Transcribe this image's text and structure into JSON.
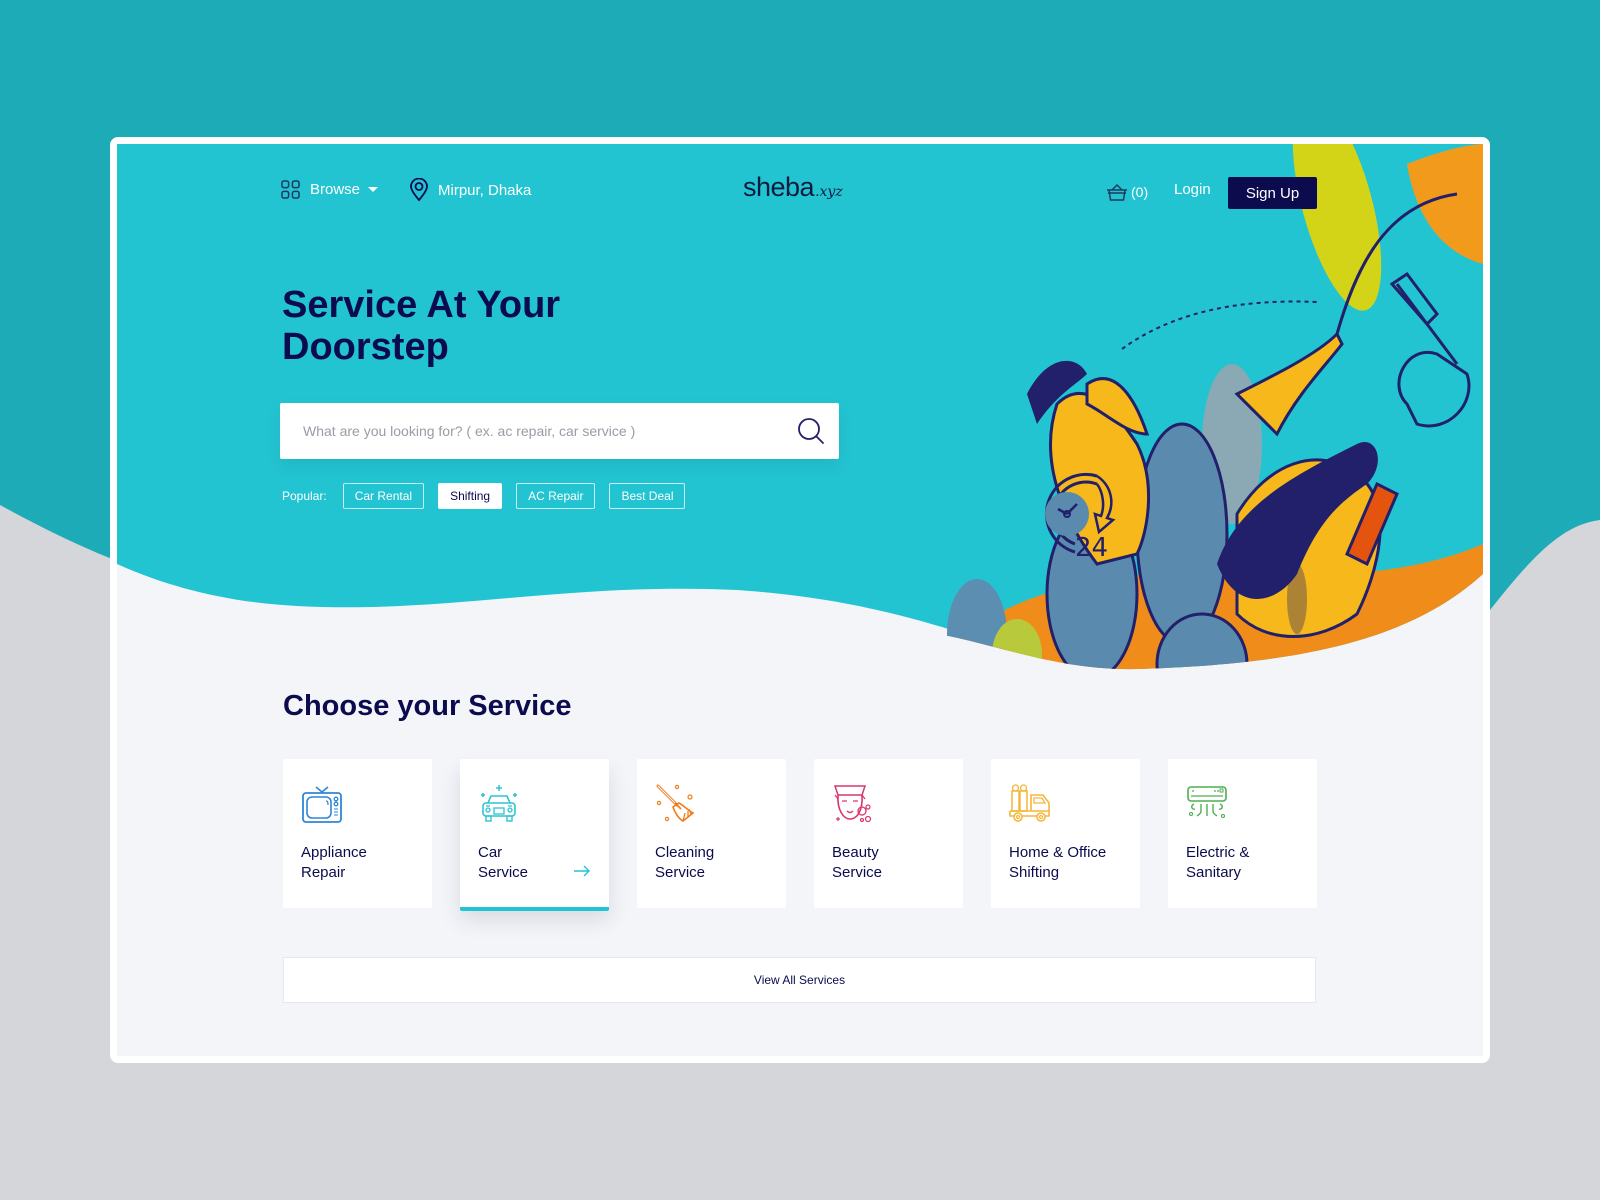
{
  "colors": {
    "hero": "#23c4d2",
    "outer_top": "#1eabb8",
    "outer_bottom": "#d5d6da",
    "navy": "#0b0b4d",
    "page_bg": "#f4f5f9"
  },
  "nav": {
    "browse_label": "Browse",
    "browse_icon": "grid-icon",
    "location_label": "Mirpur, Dhaka",
    "location_icon": "map-pin-icon",
    "logo_main": "sheba",
    "logo_suffix": ".xyz",
    "cart_icon": "basket-icon",
    "cart_count": "(0)",
    "login_label": "Login",
    "signup_label": "Sign Up"
  },
  "hero": {
    "title_line1": "Service At Your",
    "title_line2": "Doorstep",
    "search_placeholder": "What are you looking for? ( ex. ac repair, car service )",
    "search_value": "",
    "search_icon": "search-icon",
    "popular_label": "Popular:",
    "popular_tags": [
      {
        "label": "Car Rental",
        "active": false
      },
      {
        "label": "Shifting",
        "active": true
      },
      {
        "label": "AC Repair",
        "active": false
      },
      {
        "label": "Best Deal",
        "active": false
      }
    ],
    "illustration_badge": "24"
  },
  "services": {
    "title": "Choose your Service",
    "items": [
      {
        "line1": "Appliance",
        "line2": "Repair",
        "icon": "tv-icon",
        "color": "#2f86d6"
      },
      {
        "line1": "Car",
        "line2": "Service",
        "icon": "car-icon",
        "color": "#2ec4d0",
        "active": true
      },
      {
        "line1": "Cleaning",
        "line2": "Service",
        "icon": "broom-icon",
        "color": "#f07d1a"
      },
      {
        "line1": "Beauty",
        "line2": "Service",
        "icon": "face-mask-icon",
        "color": "#d9356e"
      },
      {
        "line1": "Home & Office",
        "line2": "Shifting",
        "icon": "truck-icon",
        "color": "#f5b63a"
      },
      {
        "line1": "Electric &",
        "line2": "Sanitary",
        "icon": "air-conditioner-icon",
        "color": "#4caf50"
      }
    ],
    "view_all_label": "View All Services"
  }
}
